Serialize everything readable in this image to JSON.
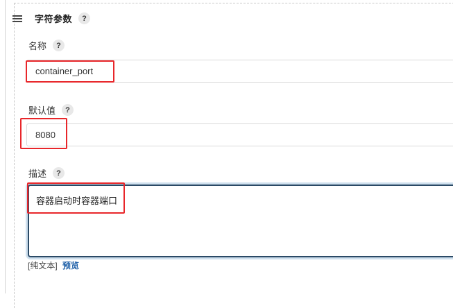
{
  "param_card": {
    "title": "字符参数",
    "help": "?"
  },
  "name_field": {
    "label": "名称",
    "help": "?",
    "value": "container_port"
  },
  "default_field": {
    "label": "默认值",
    "help": "?",
    "value": "8080"
  },
  "description_field": {
    "label": "描述",
    "help": "?",
    "value": "容器启动时容器端口",
    "format_plain": "[纯文本]",
    "format_preview": "预览"
  },
  "colors": {
    "annotation": "#e8262a",
    "link": "#1d5fa8",
    "focus_border": "#2b4a66"
  }
}
